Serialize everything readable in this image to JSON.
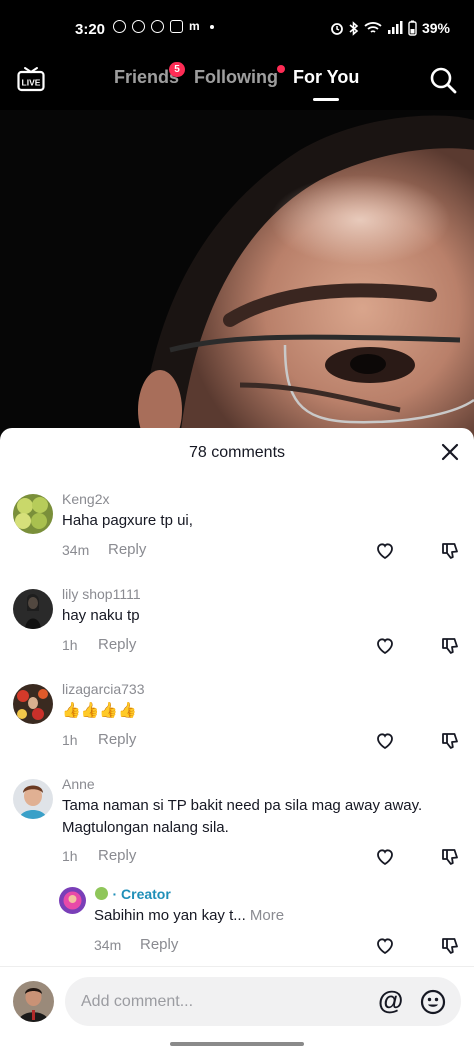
{
  "status_bar": {
    "time": "3:20",
    "left_icons": [
      "messenger-icon",
      "panda-icon",
      "check-circle-icon",
      "instagram-icon",
      "m-icon",
      "dot-icon"
    ],
    "m_glyph": "m",
    "right_icons": [
      "alarm-icon",
      "bluetooth-icon",
      "wifi-icon",
      "signal-icon",
      "battery-icon"
    ],
    "battery": "39%"
  },
  "top_nav": {
    "live_label": "LIVE",
    "tabs": [
      {
        "label": "Friends",
        "badge": "5",
        "active": false
      },
      {
        "label": "Following",
        "dot": true,
        "active": false
      },
      {
        "label": "For You",
        "active": true
      }
    ],
    "accent_color": "#fe2c55"
  },
  "comments_sheet": {
    "title": "78 comments",
    "comments": [
      {
        "user": "Keng2x",
        "text": "Haha pagxure tp ui,",
        "time": "34m",
        "reply_label": "Reply"
      },
      {
        "user": "lily shop1111",
        "text": "hay naku tp",
        "time": "1h",
        "reply_label": "Reply"
      },
      {
        "user": "lizagarcia733",
        "text": "👍👍👍👍",
        "time": "1h",
        "reply_label": "Reply"
      },
      {
        "user": "Anne",
        "text": "Tama naman si TP bakit need pa sila mag away away. Magtulongan nalang sila.",
        "time": "1h",
        "reply_label": "Reply"
      }
    ],
    "reply": {
      "creator_label": "· Creator",
      "text": "Sabihin mo yan kay t...",
      "more_label": "More",
      "time": "34m",
      "reply_label": "Reply"
    }
  },
  "input_bar": {
    "placeholder": "Add comment...",
    "at_symbol": "@"
  }
}
